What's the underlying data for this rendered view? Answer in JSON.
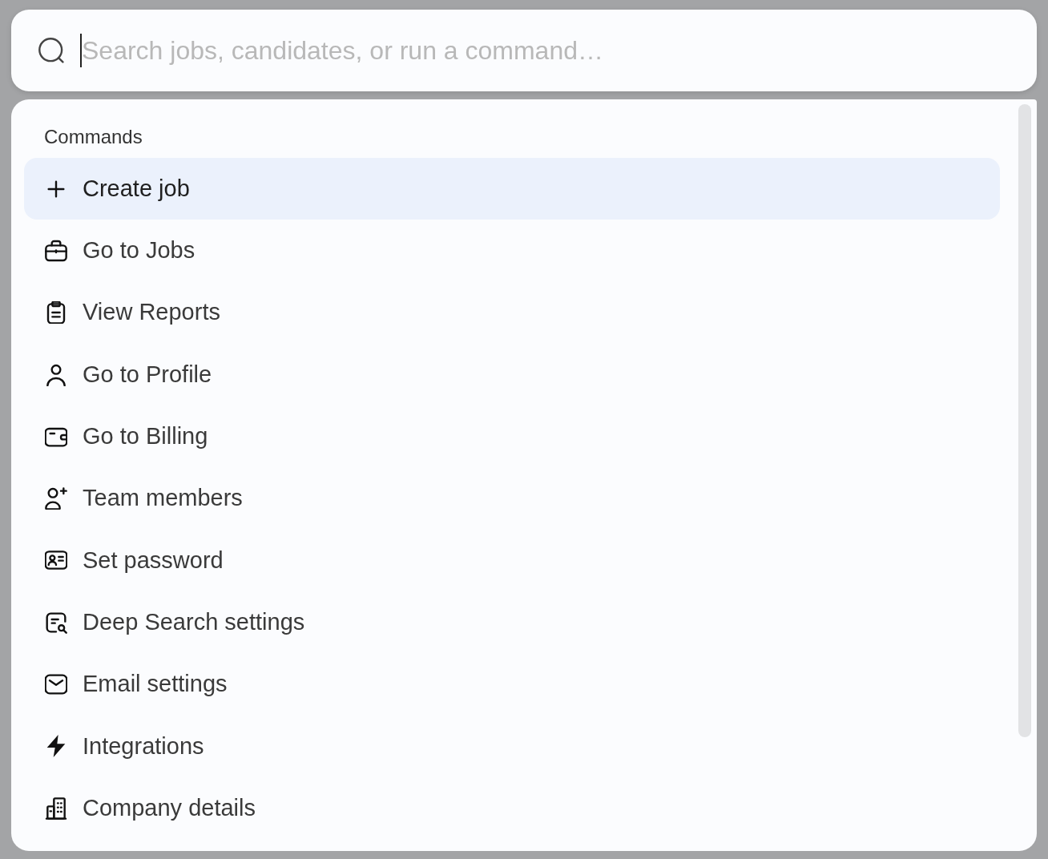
{
  "search": {
    "placeholder": "Search jobs, candidates, or run a command…",
    "focused": true
  },
  "groups": [
    {
      "heading": "Commands",
      "items": [
        {
          "label": "Create job",
          "selected": true
        },
        {
          "label": "Go to Jobs",
          "selected": false
        },
        {
          "label": "View Reports",
          "selected": false
        },
        {
          "label": "Go to Profile",
          "selected": false
        },
        {
          "label": "Go to Billing",
          "selected": false
        },
        {
          "label": "Team members",
          "selected": false
        },
        {
          "label": "Set password",
          "selected": false
        },
        {
          "label": "Deep Search settings",
          "selected": false
        },
        {
          "label": "Email settings",
          "selected": false
        },
        {
          "label": "Integrations",
          "selected": false
        },
        {
          "label": "Company details",
          "selected": false
        }
      ]
    }
  ]
}
